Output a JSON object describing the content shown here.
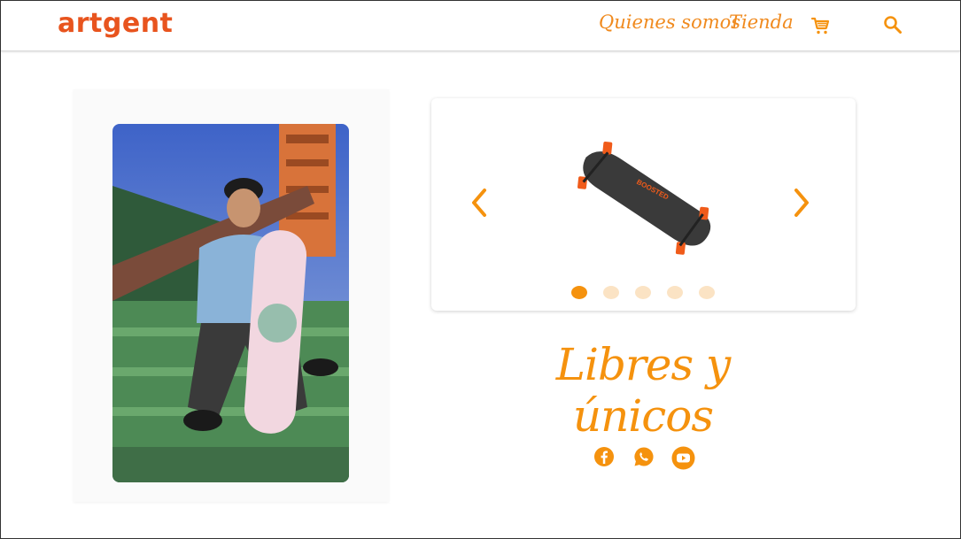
{
  "brand": {
    "logo": "artgent"
  },
  "nav": {
    "about": "Quienes somos",
    "shop": "Tienda"
  },
  "icons": {
    "cart": "shopping-cart-icon",
    "search": "search-icon",
    "prev": "chevron-left-icon",
    "next": "chevron-right-icon",
    "facebook": "facebook-icon",
    "whatsapp": "whatsapp-icon",
    "youtube": "youtube-icon"
  },
  "carousel": {
    "slides": 5,
    "active_index": 0
  },
  "hero": {
    "tagline": "Libres y únicos"
  },
  "colors": {
    "brand": "#e8541e",
    "accent": "#f5920e",
    "dot_inactive": "#fbe3c4"
  }
}
